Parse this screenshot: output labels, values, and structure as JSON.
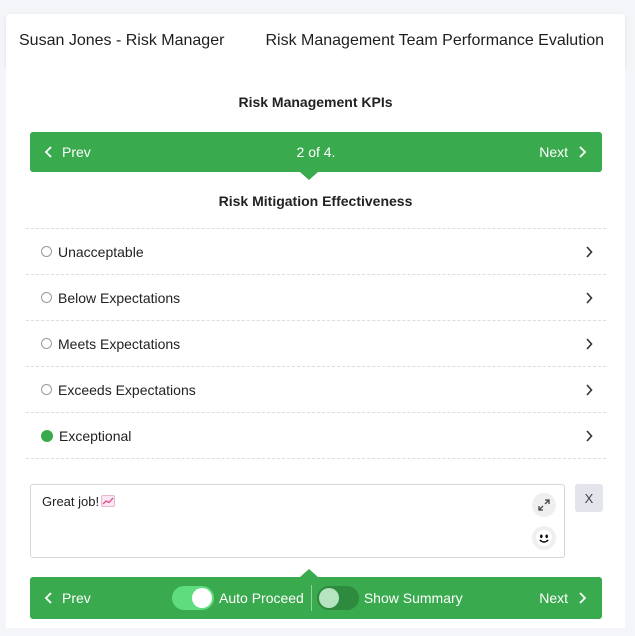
{
  "header": {
    "user": "Susan Jones - Risk Manager",
    "title": "Risk Management Team Performance Evalution"
  },
  "section": {
    "title": "Risk Management KPIs"
  },
  "top_nav": {
    "prev_label": "Prev",
    "pager": "2 of 4.",
    "next_label": "Next"
  },
  "question": {
    "title": "Risk Mitigation Effectiveness",
    "options": [
      {
        "label": "Unacceptable",
        "selected": false
      },
      {
        "label": "Below Expectations",
        "selected": false
      },
      {
        "label": "Meets Expectations",
        "selected": false
      },
      {
        "label": "Exceeds Expectations",
        "selected": false
      },
      {
        "label": "Exceptional",
        "selected": true
      }
    ]
  },
  "comment": {
    "text": "Great job!",
    "emoji": "chart-increasing-icon",
    "clear_label": "X"
  },
  "bottom_nav": {
    "prev_label": "Prev",
    "next_label": "Next",
    "auto_proceed": {
      "label": "Auto Proceed",
      "on": true
    },
    "show_summary": {
      "label": "Show Summary",
      "on": false
    }
  },
  "colors": {
    "accent": "#3aaa4e",
    "toggle_on": "#5fdc7d",
    "toggle_off": "#2d8a3e"
  }
}
